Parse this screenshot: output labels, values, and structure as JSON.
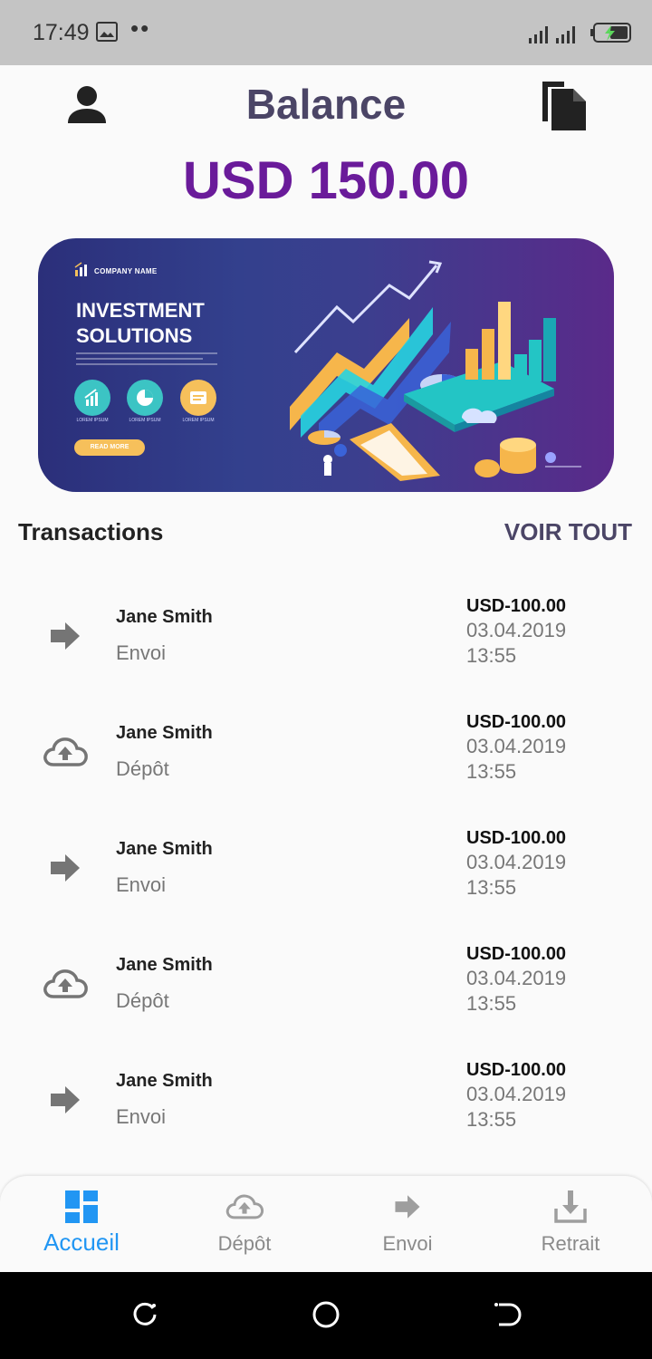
{
  "status_bar": {
    "time": "17:49",
    "dots": "••"
  },
  "header": {
    "title": "Balance"
  },
  "balance": {
    "amount": "USD 150.00"
  },
  "banner": {
    "company": "COMPANY NAME",
    "title_line1": "INVESTMENT",
    "title_line2": "SOLUTIONS",
    "items": [
      "LOREM IPSUM",
      "LOREM IPSUM",
      "LOREM IPSUM"
    ],
    "cta": "READ MORE"
  },
  "transactions": {
    "title": "Transactions",
    "see_all": "VOIR TOUT",
    "items": [
      {
        "name": "Jane Smith",
        "type": "Envoi",
        "amount": "USD-100.00",
        "date": "03.04.2019",
        "time": "13:55",
        "icon": "arrow-right-icon"
      },
      {
        "name": "Jane Smith",
        "type": "Dépôt",
        "amount": "USD-100.00",
        "date": "03.04.2019",
        "time": "13:55",
        "icon": "cloud-upload-icon"
      },
      {
        "name": "Jane Smith",
        "type": "Envoi",
        "amount": "USD-100.00",
        "date": "03.04.2019",
        "time": "13:55",
        "icon": "arrow-right-icon"
      },
      {
        "name": "Jane Smith",
        "type": "Dépôt",
        "amount": "USD-100.00",
        "date": "03.04.2019",
        "time": "13:55",
        "icon": "cloud-upload-icon"
      },
      {
        "name": "Jane Smith",
        "type": "Envoi",
        "amount": "USD-100.00",
        "date": "03.04.2019",
        "time": "13:55",
        "icon": "arrow-right-icon"
      }
    ]
  },
  "bottom_nav": {
    "items": [
      {
        "label": "Accueil",
        "icon": "dashboard-icon",
        "active": true
      },
      {
        "label": "Dépôt",
        "icon": "cloud-upload-icon",
        "active": false
      },
      {
        "label": "Envoi",
        "icon": "arrow-right-icon",
        "active": false
      },
      {
        "label": "Retrait",
        "icon": "download-icon",
        "active": false
      }
    ]
  },
  "colors": {
    "title": "#4b4566",
    "balance": "#6a1b9a",
    "nav_active": "#2196f3",
    "icon_gray": "#757575"
  }
}
